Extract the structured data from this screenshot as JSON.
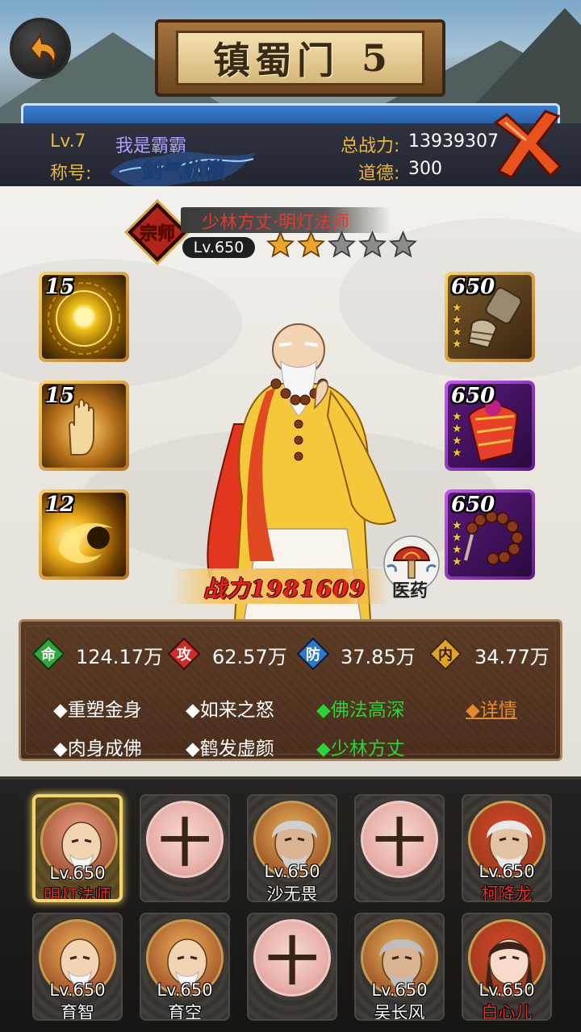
{
  "header": {
    "stage_title": "镇蜀门",
    "stage_number": "5",
    "player_level": "Lv.7",
    "player_name": "我是霸霸",
    "title_label": "称号:",
    "title_badge_text": "剑气纵横",
    "power_label": "总战力:",
    "power_value": "13939307",
    "morality_label": "道德:",
    "morality_value": "300"
  },
  "hero": {
    "rank_badge": "宗师",
    "name": "少林方丈·明灯法师",
    "level": "Lv.650",
    "stars_filled": 2,
    "stars_total": 5,
    "combat_power_label": "战力",
    "combat_power_value": "1981609",
    "medicine_label": "医药",
    "skills_slots": [
      {
        "level": "15",
        "icon": "golden-orb-icon"
      },
      {
        "level": "15",
        "icon": "buddha-palm-icon"
      },
      {
        "level": "12",
        "icon": "fire-swirl-icon"
      }
    ],
    "equip_slots": [
      {
        "level": "650",
        "icon": "gauntlet-icon",
        "rarity": "gold"
      },
      {
        "level": "650",
        "icon": "robe-icon",
        "rarity": "purple"
      },
      {
        "level": "650",
        "icon": "prayer-beads-icon",
        "rarity": "purple"
      }
    ]
  },
  "stats": {
    "hp_icon": "命",
    "hp_value": "124.17万",
    "atk_icon": "攻",
    "atk_value": "62.57万",
    "def_icon": "防",
    "def_value": "37.85万",
    "inner_icon": "内",
    "inner_value": "34.77万",
    "colors": {
      "hp": "#2fa83a",
      "atk": "#d42a26",
      "def": "#2d78c8",
      "inner": "#e0a42a"
    }
  },
  "traits": [
    {
      "label": "◆重塑金身",
      "active": false
    },
    {
      "label": "◆如来之怒",
      "active": false
    },
    {
      "label": "◆佛法高深",
      "active": true
    },
    {
      "label": "◆肉身成佛",
      "active": false
    },
    {
      "label": "◆鹤发虚颜",
      "active": false
    },
    {
      "label": "◆少林方丈",
      "active": true
    }
  ],
  "detail_link": "◆详情",
  "roster": [
    {
      "level": "Lv.650",
      "name": "明灯法师",
      "name_color": "#e0342a",
      "empty": false,
      "selected": true,
      "portrait": "bald-elder"
    },
    {
      "level": "",
      "name": "",
      "empty": true,
      "selected": false,
      "plus": "十"
    },
    {
      "level": "Lv.650",
      "name": "沙无畏",
      "name_color": "#ffffff",
      "empty": false,
      "selected": false,
      "portrait": "white-hair"
    },
    {
      "level": "",
      "name": "",
      "empty": true,
      "selected": false,
      "plus": "十"
    },
    {
      "level": "Lv.650",
      "name": "柯降龙",
      "name_color": "#e0342a",
      "empty": false,
      "selected": false,
      "portrait": "white-hair-red"
    },
    {
      "level": "Lv.650",
      "name": "育智",
      "name_color": "#ffffff",
      "empty": false,
      "selected": false,
      "portrait": "bald-monk"
    },
    {
      "level": "Lv.650",
      "name": "育空",
      "name_color": "#ffffff",
      "empty": false,
      "selected": false,
      "portrait": "bald-monk"
    },
    {
      "level": "",
      "name": "",
      "empty": true,
      "selected": false,
      "plus": "十"
    },
    {
      "level": "Lv.650",
      "name": "吴长风",
      "name_color": "#ffffff",
      "empty": false,
      "selected": false,
      "portrait": "grey-hair"
    },
    {
      "level": "Lv.650",
      "name": "白心儿",
      "name_color": "#e0342a",
      "empty": false,
      "selected": false,
      "portrait": "young-woman"
    }
  ]
}
